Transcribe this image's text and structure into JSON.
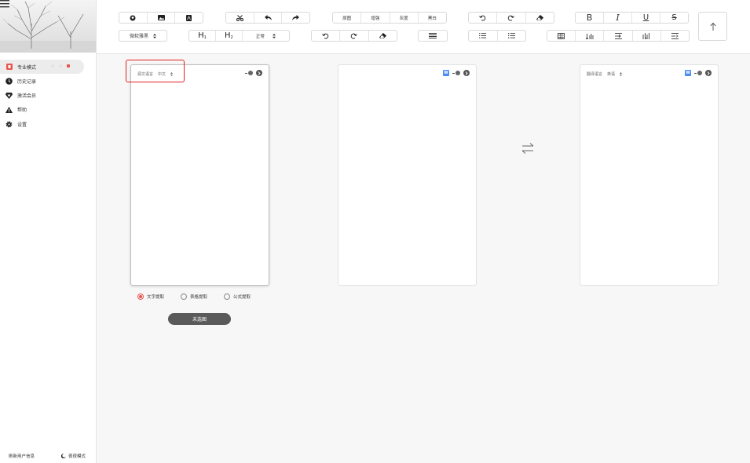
{
  "sidebar": {
    "items": [
      {
        "label": "专业模式",
        "icon": "pro-mode-icon",
        "active": true
      },
      {
        "label": "历史记录",
        "icon": "clock-icon"
      },
      {
        "label": "激活会员",
        "icon": "diamond-icon"
      },
      {
        "label": "帮助",
        "icon": "warning-icon"
      },
      {
        "label": "设置",
        "icon": "gear-icon"
      }
    ],
    "footer": {
      "refresh_label": "刷新用户信息",
      "night_label": "夜夜模式"
    }
  },
  "toolbar": {
    "image_modes": [
      "原图",
      "增强",
      "灰度",
      "黑白"
    ],
    "font_select": "微软雅黑",
    "heading1": "H",
    "heading1_sub": "1",
    "heading2": "H",
    "heading2_sub": "2",
    "paragraph_select": "正常",
    "bold": "B",
    "italic": "I",
    "underline": "U",
    "strike": "S"
  },
  "panels": {
    "source": {
      "lang_label": "源文语言",
      "lang_value": "中文"
    },
    "middle": {
      "badge": "W"
    },
    "target": {
      "lang_label": "翻译语言",
      "lang_value": "英语",
      "badge": "W"
    }
  },
  "options": {
    "modes": [
      {
        "label": "文字提取",
        "selected": true
      },
      {
        "label": "表格提取",
        "selected": false
      },
      {
        "label": "公式提取",
        "selected": false
      }
    ],
    "status_button": "未选图"
  },
  "colors": {
    "accent": "#e8544e",
    "highlight": "#e02020",
    "word_badge": "#4c8cf5"
  }
}
